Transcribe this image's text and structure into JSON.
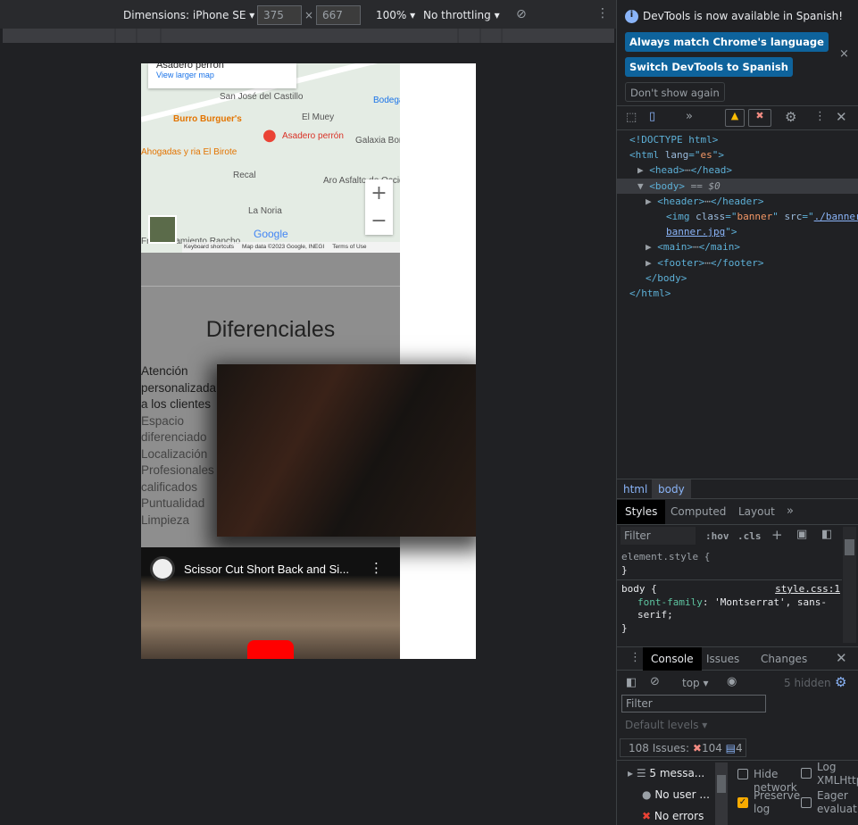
{
  "device_toolbar": {
    "dimensions_label": "Dimensions: iPhone SE",
    "width": "375",
    "height": "667",
    "times": "×",
    "zoom": "100%",
    "throttling": "No throttling"
  },
  "page": {
    "map": {
      "place_card_name": "Asadero perrón",
      "view_larger": "View larger map",
      "labels": [
        "San José del Castillo",
        "Burro Burguer's",
        "El Muey",
        "Asadero perrón",
        "Bodega Las A",
        "Galaxia Bonito Jali",
        "Ahogadas y ria El Birote",
        "Recal",
        "Aro Asfalto de Occide",
        "La Noria",
        "Fraccionamiento Rancho"
      ],
      "logo": "Google",
      "footer": [
        "Keyboard shortcuts",
        "Map data ©2023 Google, INEGI",
        "Terms of Use"
      ],
      "zoom_in": "+",
      "zoom_out": "−"
    },
    "section_title": "Diferenciales",
    "features": [
      {
        "text": "Atención personalizada a los clientes",
        "emphasis": true
      },
      {
        "text": "Espacio diferenciado"
      },
      {
        "text": "Localización"
      },
      {
        "text": "Profesionales calificados"
      },
      {
        "text": "Puntualidad"
      },
      {
        "text": "Limpieza"
      }
    ],
    "video": {
      "title": "Scissor Cut Short Back and Si..."
    }
  },
  "devtools": {
    "notice": {
      "text": "DevTools is now available in Spanish!",
      "btn_match": "Always match Chrome's language",
      "btn_switch": "Switch DevTools to Spanish",
      "btn_dont": "Don't show again"
    },
    "dom": [
      {
        "html": "<span class='tag'>&lt;!DOCTYPE html&gt;</span>",
        "indent": 0
      },
      {
        "html": "<span class='tag'>&lt;html </span><span class='attr'>lang</span><span class='tag'>=\"</span><span class='val'>es</span><span class='tag'>\"&gt;</span>",
        "indent": 0
      },
      {
        "html": "▶ <span class='tag'>&lt;head&gt;</span>⋯<span class='tag'>&lt;/head&gt;</span>",
        "indent": 1
      },
      {
        "html": "▼ <span class='tag'>&lt;body&gt;</span> <span style='color:#9aa0a6'>== <i>$0</i></span>",
        "indent": 1,
        "selected": true
      },
      {
        "html": "▶ <span class='tag'>&lt;header&gt;</span>⋯<span class='tag'>&lt;/header&gt;</span>",
        "indent": 2
      },
      {
        "html": "<span class='tag'>&lt;img </span><span class='attr'>class</span><span class='tag'>=\"</span><span class='val'>banner</span><span class='tag'>\" </span><span class='attr'>src</span><span class='tag'>=\"</span><u class='val' style='color:#8ab4f8'>./banner/</u>",
        "indent": 3
      },
      {
        "html": "<u style='color:#8ab4f8'>banner.jpg</u><span class='tag'>\"&gt;</span>",
        "indent": 3
      },
      {
        "html": "▶ <span class='tag'>&lt;main&gt;</span>⋯<span class='tag'>&lt;/main&gt;</span>",
        "indent": 2
      },
      {
        "html": "▶ <span class='tag'>&lt;footer&gt;</span>⋯<span class='tag'>&lt;/footer&gt;</span>",
        "indent": 2
      },
      {
        "html": "<span class='tag'>&lt;/body&gt;</span>",
        "indent": 2
      },
      {
        "html": "<span class='tag'>&lt;/html&gt;</span>",
        "indent": 0
      }
    ],
    "breadcrumbs": [
      "html",
      "body"
    ],
    "style_tabs": [
      "Styles",
      "Computed",
      "Layout"
    ],
    "styles": {
      "filter_placeholder": "Filter",
      "hov": ":hov",
      "cls": ".cls",
      "element_style": "element.style {",
      "close": "}",
      "rule_selector": "body {",
      "rule_source": "style.css:1",
      "prop": "font-family",
      "value": "'Montserrat', sans-serif;"
    },
    "drawer_tabs": [
      "Console",
      "Issues",
      "Changes"
    ],
    "console": {
      "context": "top",
      "hidden": "5 hidden",
      "filter_placeholder": "Filter",
      "levels": "Default levels",
      "issues_label": "108 Issues:",
      "errors": "104",
      "infos": "4",
      "sidebar": [
        "5 messa...",
        "No user ...",
        "No errors"
      ],
      "options": [
        {
          "label": "Hide network",
          "checked": false
        },
        {
          "label": "Log XMLHttp",
          "checked": false
        },
        {
          "label": "Preserve log",
          "checked": true
        },
        {
          "label": "Eager evaluatio",
          "checked": false
        }
      ]
    },
    "colors": {
      "accent": "#0e639c",
      "selected_row": "#393b40",
      "link": "#8ab4f8"
    }
  }
}
